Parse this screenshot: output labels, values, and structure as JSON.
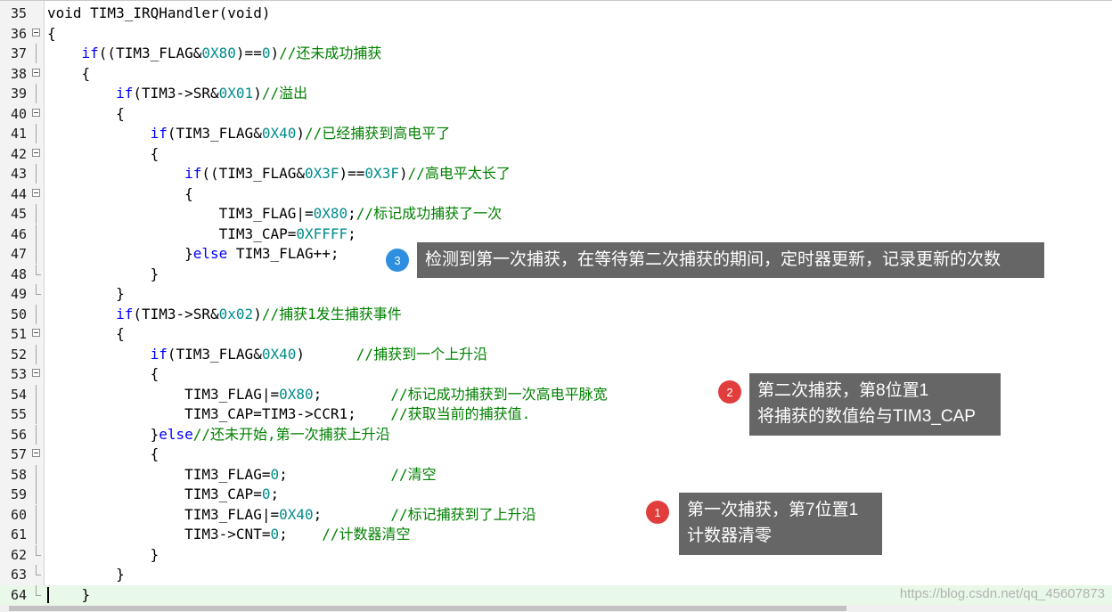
{
  "colors": {
    "keyword": "#0000ff",
    "number": "#008b8b",
    "comment": "#008000",
    "current_line_bg": "#e9f9e9",
    "tooltip_bg": "#666666",
    "badge_blue": "#2e8fe0",
    "badge_red": "#e23d3d"
  },
  "editor": {
    "current_line": 64,
    "lines": [
      {
        "n": "35",
        "fold": "none",
        "indent": "",
        "tokens": [
          {
            "t": "void TIM3_IRQHandler(void)",
            "c": ""
          }
        ]
      },
      {
        "n": "36",
        "fold": "box",
        "indent": "",
        "tokens": [
          {
            "t": "{",
            "c": ""
          }
        ]
      },
      {
        "n": "37",
        "fold": "line",
        "indent": "    ",
        "tokens": [
          {
            "t": "if",
            "c": "kw"
          },
          {
            "t": "((TIM3_FLAG&",
            "c": ""
          },
          {
            "t": "0X80",
            "c": "num"
          },
          {
            "t": ")==",
            "c": ""
          },
          {
            "t": "0",
            "c": "num"
          },
          {
            "t": ")",
            "c": ""
          },
          {
            "t": "//还未成功捕获",
            "c": "cm"
          }
        ]
      },
      {
        "n": "38",
        "fold": "box",
        "indent": "    ",
        "tokens": [
          {
            "t": "{",
            "c": ""
          }
        ]
      },
      {
        "n": "39",
        "fold": "line",
        "indent": "        ",
        "tokens": [
          {
            "t": "if",
            "c": "kw"
          },
          {
            "t": "(TIM3->SR&",
            "c": ""
          },
          {
            "t": "0X01",
            "c": "num"
          },
          {
            "t": ")",
            "c": ""
          },
          {
            "t": "//溢出",
            "c": "cm"
          }
        ]
      },
      {
        "n": "40",
        "fold": "box",
        "indent": "        ",
        "tokens": [
          {
            "t": "{",
            "c": ""
          }
        ]
      },
      {
        "n": "41",
        "fold": "line",
        "indent": "            ",
        "tokens": [
          {
            "t": "if",
            "c": "kw"
          },
          {
            "t": "(TIM3_FLAG&",
            "c": ""
          },
          {
            "t": "0X40",
            "c": "num"
          },
          {
            "t": ")",
            "c": ""
          },
          {
            "t": "//已经捕获到高电平了",
            "c": "cm"
          }
        ]
      },
      {
        "n": "42",
        "fold": "box",
        "indent": "            ",
        "tokens": [
          {
            "t": "{",
            "c": ""
          }
        ]
      },
      {
        "n": "43",
        "fold": "line",
        "indent": "                ",
        "tokens": [
          {
            "t": "if",
            "c": "kw"
          },
          {
            "t": "((TIM3_FLAG&",
            "c": ""
          },
          {
            "t": "0X3F",
            "c": "num"
          },
          {
            "t": ")==",
            "c": ""
          },
          {
            "t": "0X3F",
            "c": "num"
          },
          {
            "t": ")",
            "c": ""
          },
          {
            "t": "//高电平太长了",
            "c": "cm"
          }
        ]
      },
      {
        "n": "44",
        "fold": "box",
        "indent": "                ",
        "tokens": [
          {
            "t": "{",
            "c": ""
          }
        ]
      },
      {
        "n": "45",
        "fold": "line",
        "indent": "                    ",
        "tokens": [
          {
            "t": "TIM3_FLAG|=",
            "c": ""
          },
          {
            "t": "0X80",
            "c": "num"
          },
          {
            "t": ";",
            "c": ""
          },
          {
            "t": "//标记成功捕获了一次",
            "c": "cm"
          }
        ]
      },
      {
        "n": "46",
        "fold": "line",
        "indent": "                    ",
        "tokens": [
          {
            "t": "TIM3_CAP=",
            "c": ""
          },
          {
            "t": "0XFFFF",
            "c": "num"
          },
          {
            "t": ";",
            "c": ""
          }
        ]
      },
      {
        "n": "47",
        "fold": "line",
        "indent": "                ",
        "tokens": [
          {
            "t": "}",
            "c": ""
          },
          {
            "t": "else",
            "c": "kw"
          },
          {
            "t": " TIM3_FLAG++;",
            "c": ""
          }
        ]
      },
      {
        "n": "48",
        "fold": "end",
        "indent": "            ",
        "tokens": [
          {
            "t": "}",
            "c": ""
          }
        ]
      },
      {
        "n": "49",
        "fold": "end",
        "indent": "        ",
        "tokens": [
          {
            "t": "}",
            "c": ""
          }
        ]
      },
      {
        "n": "50",
        "fold": "line",
        "indent": "        ",
        "tokens": [
          {
            "t": "if",
            "c": "kw"
          },
          {
            "t": "(TIM3->SR&",
            "c": ""
          },
          {
            "t": "0x02",
            "c": "num"
          },
          {
            "t": ")",
            "c": ""
          },
          {
            "t": "//捕获1发生捕获事件",
            "c": "cm"
          }
        ]
      },
      {
        "n": "51",
        "fold": "box",
        "indent": "        ",
        "tokens": [
          {
            "t": "{",
            "c": ""
          }
        ]
      },
      {
        "n": "52",
        "fold": "line",
        "indent": "            ",
        "tokens": [
          {
            "t": "if",
            "c": "kw"
          },
          {
            "t": "(TIM3_FLAG&",
            "c": ""
          },
          {
            "t": "0X40",
            "c": "num"
          },
          {
            "t": ")      ",
            "c": ""
          },
          {
            "t": "//捕获到一个上升沿",
            "c": "cm"
          }
        ]
      },
      {
        "n": "53",
        "fold": "box",
        "indent": "            ",
        "tokens": [
          {
            "t": "{",
            "c": ""
          }
        ]
      },
      {
        "n": "54",
        "fold": "line",
        "indent": "                ",
        "tokens": [
          {
            "t": "TIM3_FLAG|=",
            "c": ""
          },
          {
            "t": "0X80",
            "c": "num"
          },
          {
            "t": ";        ",
            "c": ""
          },
          {
            "t": "//标记成功捕获到一次高电平脉宽",
            "c": "cm"
          }
        ]
      },
      {
        "n": "55",
        "fold": "line",
        "indent": "                ",
        "tokens": [
          {
            "t": "TIM3_CAP=TIM3->CCR1;    ",
            "c": ""
          },
          {
            "t": "//获取当前的捕获值.",
            "c": "cm"
          }
        ]
      },
      {
        "n": "56",
        "fold": "line",
        "indent": "            ",
        "tokens": [
          {
            "t": "}",
            "c": ""
          },
          {
            "t": "else",
            "c": "kw"
          },
          {
            "t": "//还未开始,第一次捕获上升沿",
            "c": "cm"
          }
        ]
      },
      {
        "n": "57",
        "fold": "box",
        "indent": "            ",
        "tokens": [
          {
            "t": "{",
            "c": ""
          }
        ]
      },
      {
        "n": "58",
        "fold": "line",
        "indent": "                ",
        "tokens": [
          {
            "t": "TIM3_FLAG=",
            "c": ""
          },
          {
            "t": "0",
            "c": "num"
          },
          {
            "t": ";            ",
            "c": ""
          },
          {
            "t": "//清空",
            "c": "cm"
          }
        ]
      },
      {
        "n": "59",
        "fold": "line",
        "indent": "                ",
        "tokens": [
          {
            "t": "TIM3_CAP=",
            "c": ""
          },
          {
            "t": "0",
            "c": "num"
          },
          {
            "t": ";",
            "c": ""
          }
        ]
      },
      {
        "n": "60",
        "fold": "line",
        "indent": "                ",
        "tokens": [
          {
            "t": "TIM3_FLAG|=",
            "c": ""
          },
          {
            "t": "0X40",
            "c": "num"
          },
          {
            "t": ";        ",
            "c": ""
          },
          {
            "t": "//标记捕获到了上升沿",
            "c": "cm"
          }
        ]
      },
      {
        "n": "61",
        "fold": "line",
        "indent": "                ",
        "tokens": [
          {
            "t": "TIM3->CNT=",
            "c": ""
          },
          {
            "t": "0",
            "c": "num"
          },
          {
            "t": ";    ",
            "c": ""
          },
          {
            "t": "//计数器清空",
            "c": "cm"
          }
        ]
      },
      {
        "n": "62",
        "fold": "end",
        "indent": "            ",
        "tokens": [
          {
            "t": "}",
            "c": ""
          }
        ]
      },
      {
        "n": "63",
        "fold": "end",
        "indent": "        ",
        "tokens": [
          {
            "t": "}",
            "c": ""
          }
        ]
      },
      {
        "n": "64",
        "fold": "end",
        "indent": "    ",
        "tokens": [
          {
            "t": "}",
            "c": ""
          }
        ]
      }
    ]
  },
  "annotations": [
    {
      "badge": "3",
      "color": "blue",
      "lines": [
        "检测到第一次捕获，在等待第二次捕获的期间，定时器更新，记录更新的次数"
      ]
    },
    {
      "badge": "2",
      "color": "red",
      "lines": [
        "第二次捕获，第8位置1",
        "将捕获的数值给与TIM3_CAP"
      ]
    },
    {
      "badge": "1",
      "color": "red",
      "lines": [
        "第一次捕获，第7位置1",
        "计数器清零"
      ]
    }
  ],
  "watermark": "https://blog.csdn.net/qq_45607873"
}
